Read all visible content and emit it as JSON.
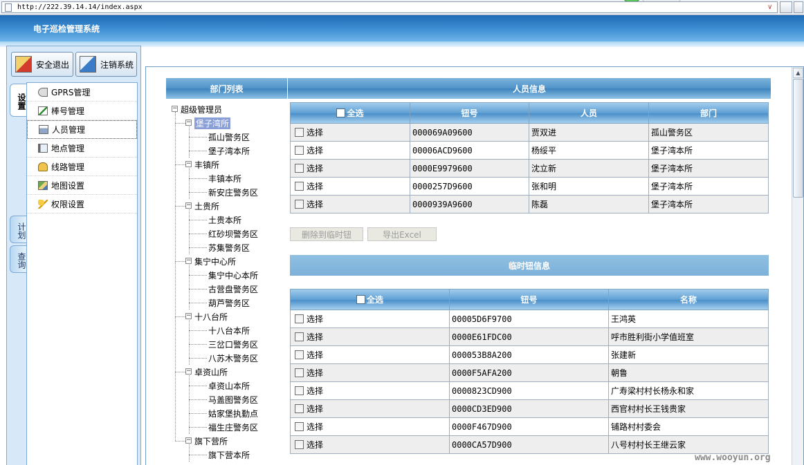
{
  "address_bar": {
    "url": "http://222.39.14.14/index.aspx"
  },
  "header": {
    "title": "电子巡检管理系统"
  },
  "top_buttons": {
    "exit": "安全退出",
    "logoff": "注销系统"
  },
  "side_tabs": {
    "settings": "设置",
    "plan": "计划",
    "query": "查询"
  },
  "menu": [
    {
      "label": "GPRS管理",
      "icon": "gprs-icon"
    },
    {
      "label": "棒号管理",
      "icon": "stick-icon"
    },
    {
      "label": "人员管理",
      "icon": "person-icon",
      "selected": true
    },
    {
      "label": "地点管理",
      "icon": "place-icon"
    },
    {
      "label": "线路管理",
      "icon": "route-icon"
    },
    {
      "label": "地图设置",
      "icon": "map-icon"
    },
    {
      "label": "权限设置",
      "icon": "key-icon"
    }
  ],
  "dept_panel": {
    "title": "部门列表"
  },
  "tree": {
    "root": "超级管理员",
    "groups": [
      {
        "name": "堡子湾所",
        "selected": true,
        "children": [
          "孤山警务区",
          "堡子湾本所"
        ]
      },
      {
        "name": "丰镇所",
        "children": [
          "丰镇本所",
          "新安庄警务区"
        ]
      },
      {
        "name": "土贵所",
        "children": [
          "土贵本所",
          "红砂坝警务区",
          "苏集警务区"
        ]
      },
      {
        "name": "集宁中心所",
        "children": [
          "集宁中心本所",
          "古营盘警务区",
          "葫芦警务区"
        ]
      },
      {
        "name": "十八台所",
        "children": [
          "十八台本所",
          "三岔口警务区",
          "八苏木警务区"
        ]
      },
      {
        "name": "卓资山所",
        "children": [
          "卓资山本所",
          "马盖图警务区",
          "姑家堡执勤点",
          "福生庄警务区"
        ]
      },
      {
        "name": "旗下营所",
        "children": [
          "旗下营本所"
        ]
      }
    ]
  },
  "person_panel": {
    "title": "人员信息",
    "columns": [
      "全选",
      "钮号",
      "人员",
      "部门"
    ],
    "select_label": "选择",
    "rows": [
      {
        "code": "000069A09600",
        "person": "贾双进",
        "dept": "孤山警务区"
      },
      {
        "code": "00006ACD9600",
        "person": "杨绥平",
        "dept": "堡子湾本所"
      },
      {
        "code": "0000E9979600",
        "person": "沈立新",
        "dept": "堡子湾本所"
      },
      {
        "code": "0000257D9600",
        "person": "张和明",
        "dept": "堡子湾本所"
      },
      {
        "code": "0000939A9600",
        "person": "陈磊",
        "dept": "堡子湾本所"
      }
    ]
  },
  "actions": {
    "delete_temp": "删除到临时钮",
    "export_excel": "导出Excel"
  },
  "temp_panel": {
    "title": "临时钮信息",
    "columns": [
      "全选",
      "钮号",
      "名称"
    ],
    "select_label": "选择",
    "rows": [
      {
        "code": "00005D6F9700",
        "name": "王鸿英"
      },
      {
        "code": "0000E61FDC00",
        "name": "呼市胜利街小学值班室"
      },
      {
        "code": "000053B8A200",
        "name": "张建新"
      },
      {
        "code": "0000F5AFA200",
        "name": "朝鲁"
      },
      {
        "code": "0000823CD900",
        "name": "广寿梁村村长杨永和家"
      },
      {
        "code": "0000CD3ED900",
        "name": "西官村村长王钱贵家"
      },
      {
        "code": "0000F467D900",
        "name": "铺路村村委会"
      },
      {
        "code": "0000CA57D900",
        "name": "八号村村长王继云家"
      }
    ]
  },
  "watermark": "www.wooyun.org"
}
